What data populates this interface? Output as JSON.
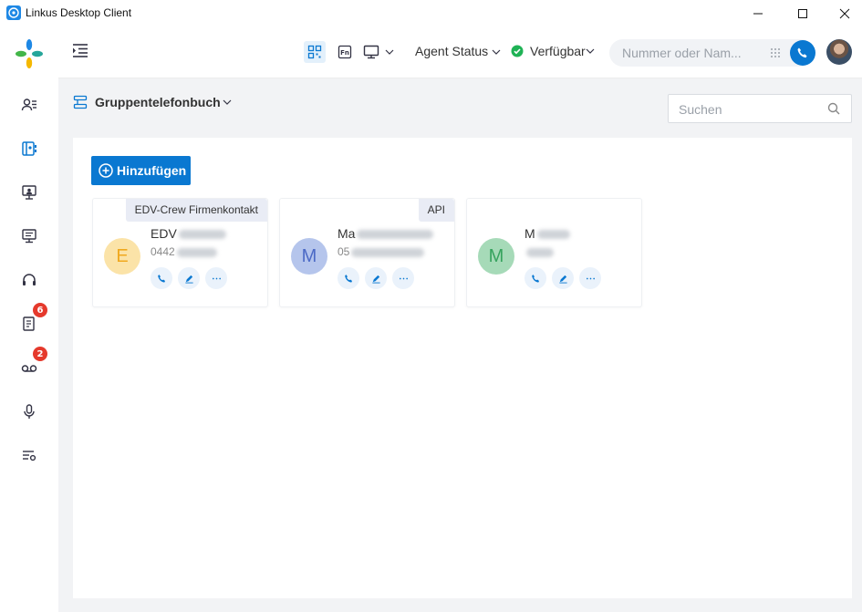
{
  "window": {
    "title": "Linkus Desktop Client"
  },
  "sidebar": {
    "items": [
      {
        "name": "contacts",
        "icon": "contacts-icon"
      },
      {
        "name": "phonebook",
        "icon": "phonebook-icon",
        "active": true
      },
      {
        "name": "conference",
        "icon": "conference-icon"
      },
      {
        "name": "monitor",
        "icon": "monitor-icon"
      },
      {
        "name": "headset",
        "icon": "headset-icon"
      },
      {
        "name": "call-log",
        "icon": "call-log-icon",
        "badge": "6"
      },
      {
        "name": "voicemail",
        "icon": "voicemail-icon",
        "badge": "2"
      },
      {
        "name": "recordings",
        "icon": "microphone-icon"
      },
      {
        "name": "settings",
        "icon": "list-settings-icon"
      }
    ]
  },
  "topbar": {
    "agent_status_label": "Agent Status",
    "presence_label": "Verfügbar",
    "dial_placeholder": "Nummer oder Nam..."
  },
  "main": {
    "phonebook_title": "Gruppentelefonbuch",
    "search_placeholder": "Suchen",
    "add_button_label": "Hinzufügen",
    "contacts": [
      {
        "initial": "E",
        "name_visible": "EDV",
        "number_visible": "0442",
        "tag": "EDV-Crew Firmenkontakt",
        "avatar_bg": "#fbe3a8",
        "avatar_fg": "#f0a81e"
      },
      {
        "initial": "M",
        "name_visible": "Ma",
        "number_visible": "05",
        "tag": "API",
        "avatar_bg": "#b5c5ec",
        "avatar_fg": "#4c6ac6"
      },
      {
        "initial": "M",
        "name_visible": "M",
        "number_visible": "",
        "tag": "",
        "avatar_bg": "#a6dab8",
        "avatar_fg": "#36a35e"
      }
    ]
  },
  "colors": {
    "accent": "#0a78d1",
    "presence_green": "#1fb255",
    "badge_red": "#e5392c"
  }
}
